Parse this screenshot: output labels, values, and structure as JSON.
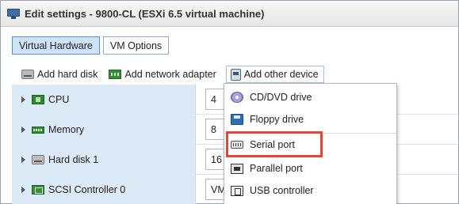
{
  "window": {
    "title": "Edit settings - 9800-CL (ESXi 6.5 virtual machine)",
    "icon": "vm-icon"
  },
  "tabs": [
    {
      "label": "Virtual Hardware",
      "active": true
    },
    {
      "label": "VM Options",
      "active": false
    }
  ],
  "toolbar": {
    "add_hard_disk": "Add hard disk",
    "add_network_adapter": "Add network adapter",
    "add_other_device": "Add other device"
  },
  "hardware_rows": [
    {
      "label": "CPU",
      "icon": "cpu-icon",
      "value": "4"
    },
    {
      "label": "Memory",
      "icon": "memory-icon",
      "value": "8"
    },
    {
      "label": "Hard disk 1",
      "icon": "hard-disk-icon",
      "value": "16"
    },
    {
      "label": "SCSI Controller 0",
      "icon": "scsi-controller-icon",
      "value": "VMw"
    }
  ],
  "device_menu": {
    "items": [
      {
        "label": "CD/DVD drive",
        "icon": "cd-dvd-icon"
      },
      {
        "label": "Floppy drive",
        "icon": "floppy-icon"
      },
      {
        "label": "Serial port",
        "icon": "serial-port-icon",
        "highlighted": true
      },
      {
        "label": "Parallel port",
        "icon": "parallel-port-icon"
      },
      {
        "label": "USB controller",
        "icon": "usb-controller-icon"
      }
    ]
  },
  "colors": {
    "tab_active_bg": "#cfe3f7",
    "row_label_bg": "#dce9f6",
    "highlight_border": "#e0463a"
  }
}
